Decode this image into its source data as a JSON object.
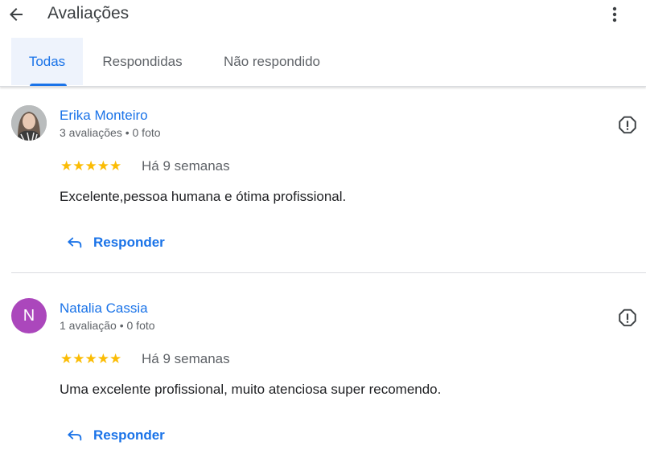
{
  "header": {
    "title": "Avaliações"
  },
  "tabs": [
    {
      "label": "Todas",
      "active": true
    },
    {
      "label": "Respondidas",
      "active": false
    },
    {
      "label": "Não respondido",
      "active": false
    }
  ],
  "colors": {
    "accent": "#1a73e8",
    "star": "#fbbc04",
    "avatar_letter_bg": "#ab47bc"
  },
  "reviews": [
    {
      "name": "Erika Monteiro",
      "meta": "3 avaliações • 0 foto",
      "rating": 5,
      "stars": "★★★★★",
      "time": "Há 9 semanas",
      "text": "Excelente,pessoa humana e ótima profissional.",
      "reply_label": "Responder",
      "avatar_type": "photo"
    },
    {
      "name": "Natalia Cassia",
      "meta": "1 avaliação • 0 foto",
      "rating": 5,
      "stars": "★★★★★",
      "time": "Há 9 semanas",
      "text": "Uma excelente profissional, muito atenciosa super recomendo.",
      "reply_label": "Responder",
      "avatar_letter": "N"
    }
  ]
}
